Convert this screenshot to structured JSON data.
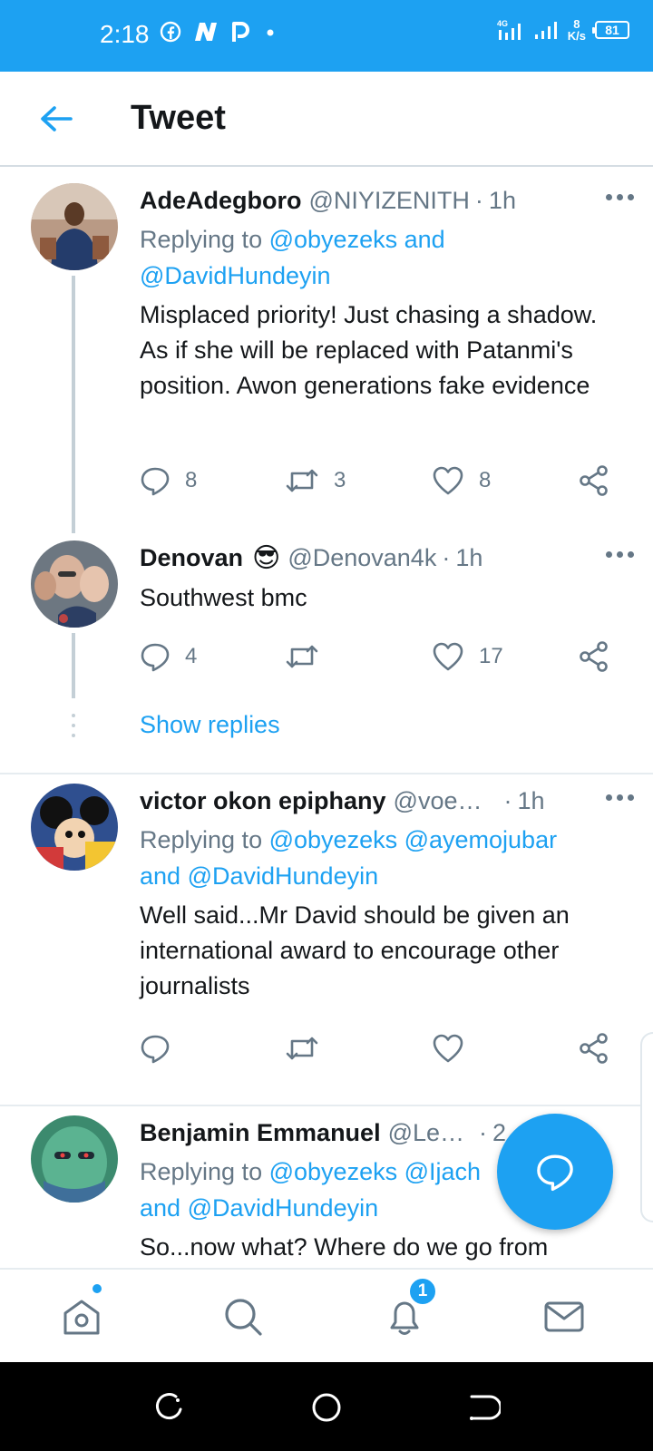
{
  "status_bar": {
    "time": "2:18",
    "net_rate_value": "8",
    "net_rate_unit": "K/s",
    "battery": "81",
    "network": "4G"
  },
  "header": {
    "title": "Tweet",
    "back_icon": "arrow-left-icon"
  },
  "tweets": [
    {
      "name": "AdeAdegboro",
      "handle": "@NIYIZENITH",
      "time": "1h",
      "replying_prefix": "Replying to",
      "replying_line1_link": "@obyezeks",
      "replying_line1_tail": "and",
      "replying_line2_link": "@DavidHundeyin",
      "text": "Misplaced priority! Just chasing a shadow. As if she will be replaced with Patanmi's position. Awon generations fake evidence",
      "replies": "8",
      "retweets": "3",
      "likes": "8"
    },
    {
      "name": "Denovan",
      "emoji": "😎",
      "handle": "@Denovan4k",
      "time": "1h",
      "text": "Southwest bmc",
      "replies": "4",
      "retweets": "",
      "likes": "17"
    },
    {
      "name": "victor okon epiphany",
      "handle": "@voe…",
      "time": "1h",
      "replying_prefix": "Replying to",
      "replying_line1_link": "@obyezeks @ayemojubar",
      "replying_line2_pre": "and",
      "replying_line2_link": "@DavidHundeyin",
      "text": "Well said...Mr David should be given an international award to encourage other journalists"
    },
    {
      "name": "Benjamin Emmanuel",
      "handle": "@Le…",
      "time": "2",
      "replying_prefix": "Replying to",
      "replying_line1_link": "@obyezeks @Ijach",
      "replying_line2_pre": "and",
      "replying_line2_link": "@DavidHundeyin",
      "text": "So...now what? Where do we go from"
    }
  ],
  "show_replies": "Show replies",
  "bottom_nav": {
    "notifications_badge": "1",
    "items": [
      "home-icon",
      "search-icon",
      "bell-icon",
      "mail-icon"
    ]
  },
  "colors": {
    "accent": "#1da1f2",
    "text": "#14171a",
    "muted": "#657786"
  }
}
